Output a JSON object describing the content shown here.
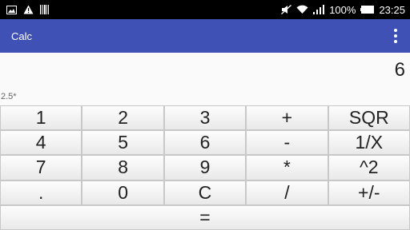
{
  "status_bar": {
    "battery_percent": "100%",
    "time": "23:25",
    "left_icons": [
      "image-icon",
      "warning-icon",
      "barcode-icon"
    ],
    "right_icons": [
      "mute-icon",
      "wifi-icon",
      "signal-icon",
      "battery-icon"
    ]
  },
  "app_bar": {
    "title": "Calc",
    "background": "#3f51b5",
    "menu_icon": "overflow-menu-icon"
  },
  "display": {
    "result": "6",
    "expression": "2.5*"
  },
  "keypad": {
    "keys": [
      [
        "1",
        "2",
        "3",
        "+",
        "SQR"
      ],
      [
        "4",
        "5",
        "6",
        "-",
        "1/X"
      ],
      [
        "7",
        "8",
        "9",
        "*",
        "^2"
      ],
      [
        ".",
        "0",
        "C",
        "/",
        "+/-"
      ]
    ],
    "equals": "="
  }
}
